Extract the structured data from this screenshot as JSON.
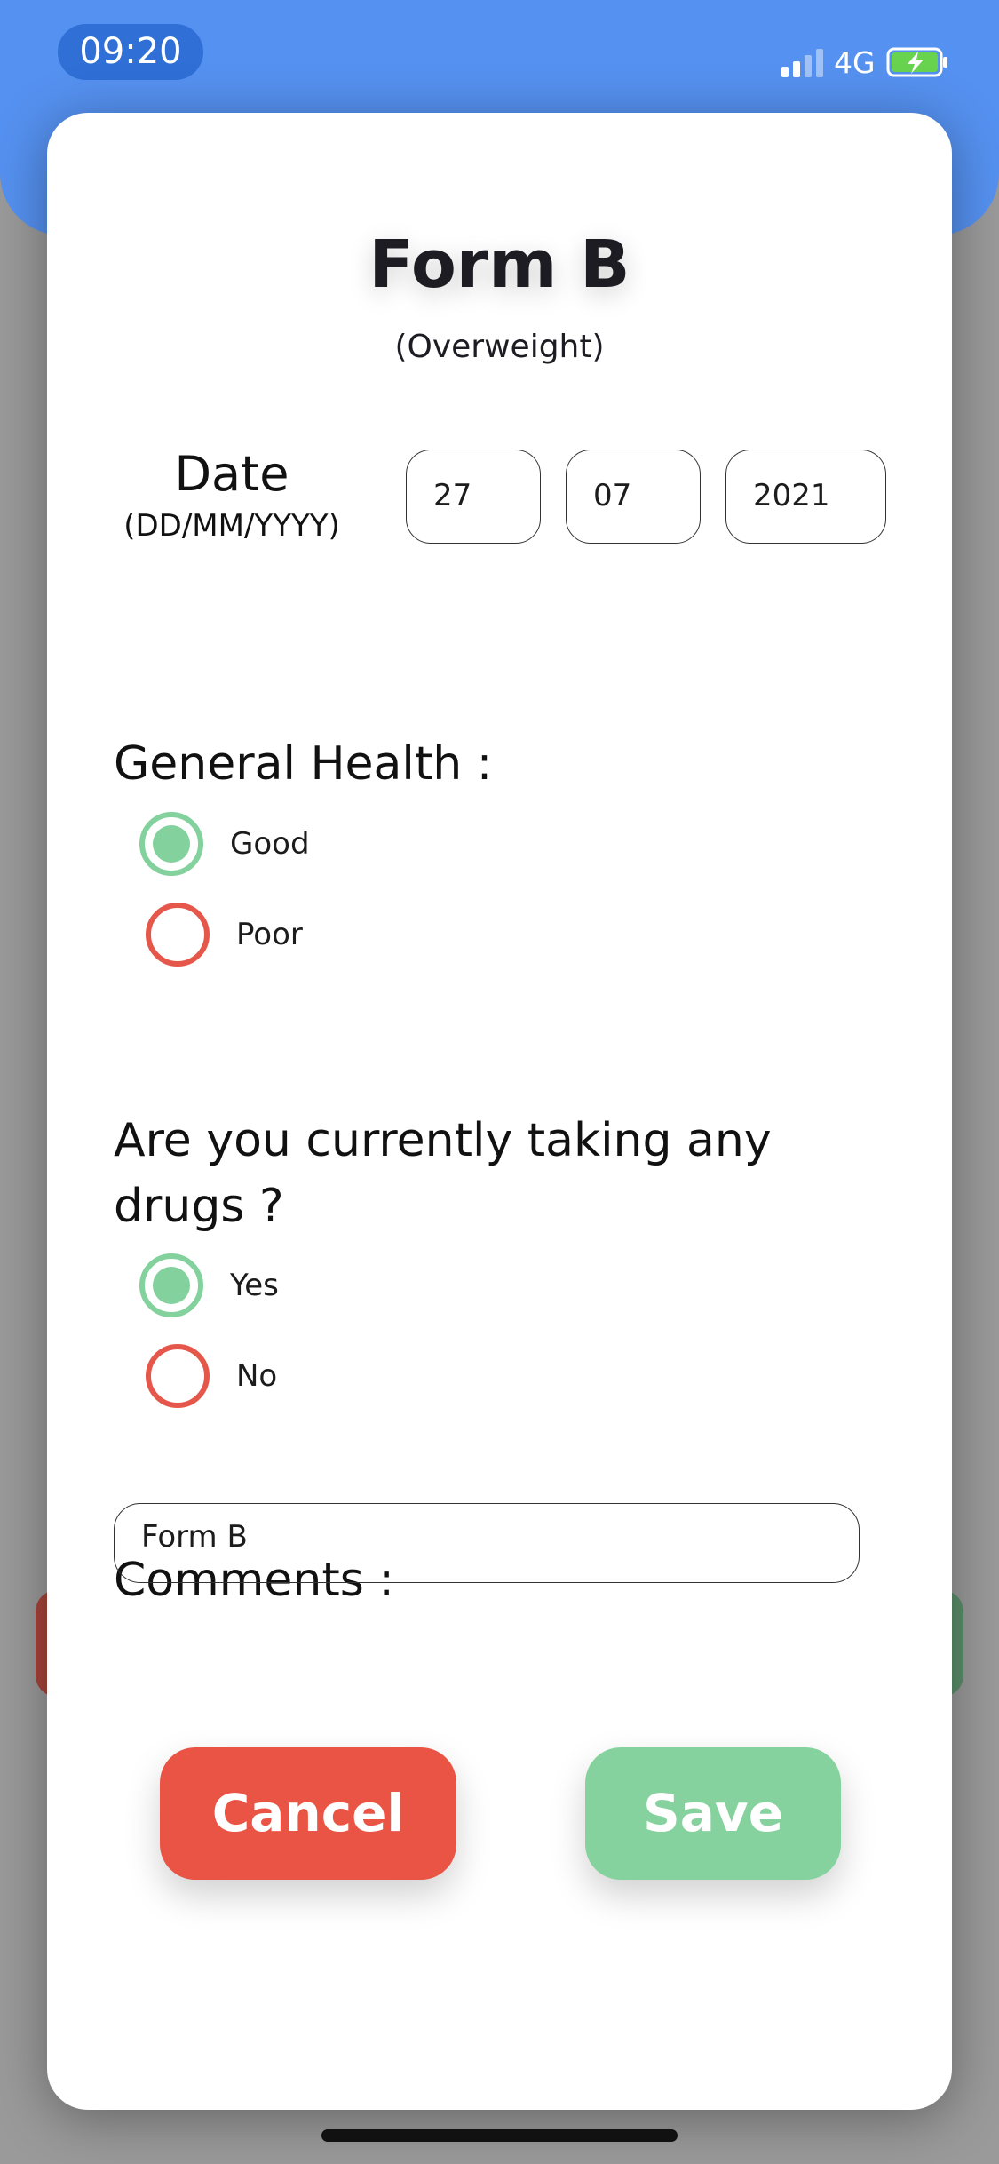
{
  "status_bar": {
    "time": "09:20",
    "network": "4G",
    "signal_bars_filled": 2,
    "signal_bars_total": 4,
    "battery_state": "charging"
  },
  "form": {
    "title": "Form B",
    "subtitle": "(Overweight)",
    "date": {
      "label": "Date",
      "format": "(DD/MM/YYYY)",
      "day": "27",
      "month": "07",
      "year": "2021"
    },
    "general_health": {
      "question": "General Health :",
      "options": [
        {
          "label": "Good",
          "selected": true
        },
        {
          "label": "Poor",
          "selected": false
        }
      ]
    },
    "drugs": {
      "question_line1": "Are you currently taking any",
      "question_line2": "drugs ?",
      "options": [
        {
          "label": "Yes",
          "selected": true
        },
        {
          "label": "No",
          "selected": false
        }
      ]
    },
    "comments": {
      "label": "Comments :",
      "value": "Form B"
    },
    "cancel_label": "Cancel",
    "save_label": "Save"
  },
  "colors": {
    "header_blue": "#5591f0",
    "selected_green": "#83d19c",
    "unselected_red": "#e5574a",
    "cancel_red": "#ea5444",
    "save_green": "#86d29e"
  }
}
